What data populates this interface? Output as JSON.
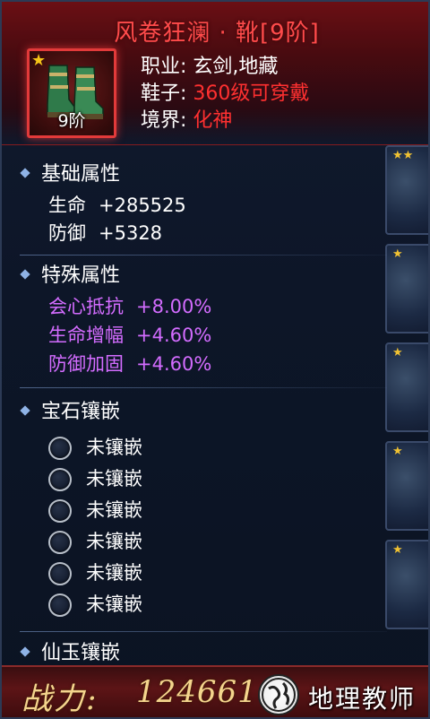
{
  "header": {
    "title": "风卷狂澜 · 靴[9阶]",
    "item_tier": "9阶",
    "meta": [
      {
        "key": "职业:",
        "value": "玄剑,地藏",
        "color": "white"
      },
      {
        "key": "鞋子:",
        "value": "360级可穿戴",
        "color": "red"
      },
      {
        "key": "境界:",
        "value": "化神",
        "color": "red"
      }
    ]
  },
  "basic": {
    "title": "基础属性",
    "rows": [
      {
        "name": "生命",
        "value": "+285525"
      },
      {
        "name": "防御",
        "value": "+5328"
      }
    ]
  },
  "special": {
    "title": "特殊属性",
    "rows": [
      {
        "name": "会心抵抗",
        "value": "+8.00%"
      },
      {
        "name": "生命增幅",
        "value": "+4.60%"
      },
      {
        "name": "防御加固",
        "value": "+4.60%"
      }
    ]
  },
  "gems": {
    "title": "宝石镶嵌",
    "slots": [
      "未镶嵌",
      "未镶嵌",
      "未镶嵌",
      "未镶嵌",
      "未镶嵌",
      "未镶嵌"
    ]
  },
  "jade": {
    "title": "仙玉镶嵌"
  },
  "power": {
    "label": "战力:",
    "value": "124661"
  },
  "watermark": {
    "text": "地理教师"
  },
  "colors": {
    "title_red": "#ff4b4b",
    "value_red": "#ff3030",
    "special_purple": "#d36cff",
    "power_gold": "#f4d58d"
  }
}
